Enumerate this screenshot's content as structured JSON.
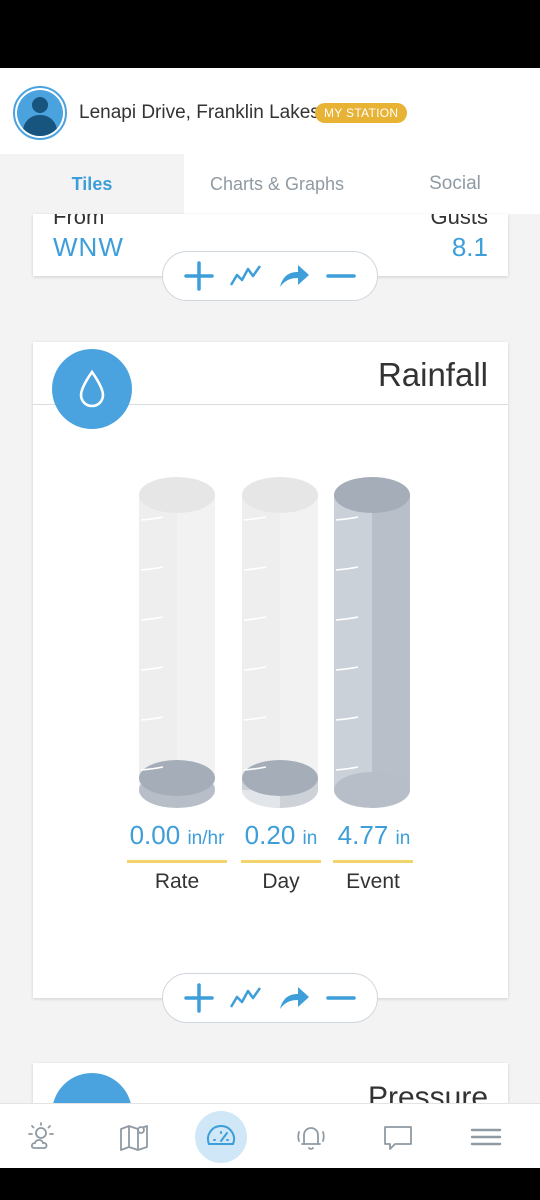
{
  "header": {
    "station_name": "Lenapi Drive, Franklin Lakes",
    "badge": "MY STATION"
  },
  "tabs": [
    {
      "label": "Tiles",
      "active": true
    },
    {
      "label": "Charts & Graphs",
      "active": false
    },
    {
      "label": "Social",
      "active": false
    }
  ],
  "wind": {
    "from_label": "From",
    "from_value": "WNW",
    "gusts_label": "Gusts",
    "gusts_value": "8.1"
  },
  "rainfall": {
    "title": "Rainfall",
    "icon": "raindrop-icon",
    "gauges": [
      {
        "value": "0.00",
        "unit": "in/hr",
        "label": "Rate",
        "fill_fraction": 0.0
      },
      {
        "value": "0.20",
        "unit": "in",
        "label": "Day",
        "fill_fraction": 0.04
      },
      {
        "value": "4.77",
        "unit": "in",
        "label": "Event",
        "fill_fraction": 1.0
      }
    ]
  },
  "pressure": {
    "title": "Pressure",
    "icon": "gauge-icon"
  },
  "bottom_nav": [
    {
      "icon": "weather-icon",
      "active": false
    },
    {
      "icon": "map-icon",
      "active": false
    },
    {
      "icon": "dashboard-icon",
      "active": true
    },
    {
      "icon": "bell-icon",
      "active": false
    },
    {
      "icon": "chat-icon",
      "active": false
    },
    {
      "icon": "menu-icon",
      "active": false
    }
  ],
  "colors": {
    "accent": "#3d9ed9",
    "icon_circle": "#4aa3df",
    "badge": "#e8b234",
    "gauge_underline": "#f3d46a"
  }
}
